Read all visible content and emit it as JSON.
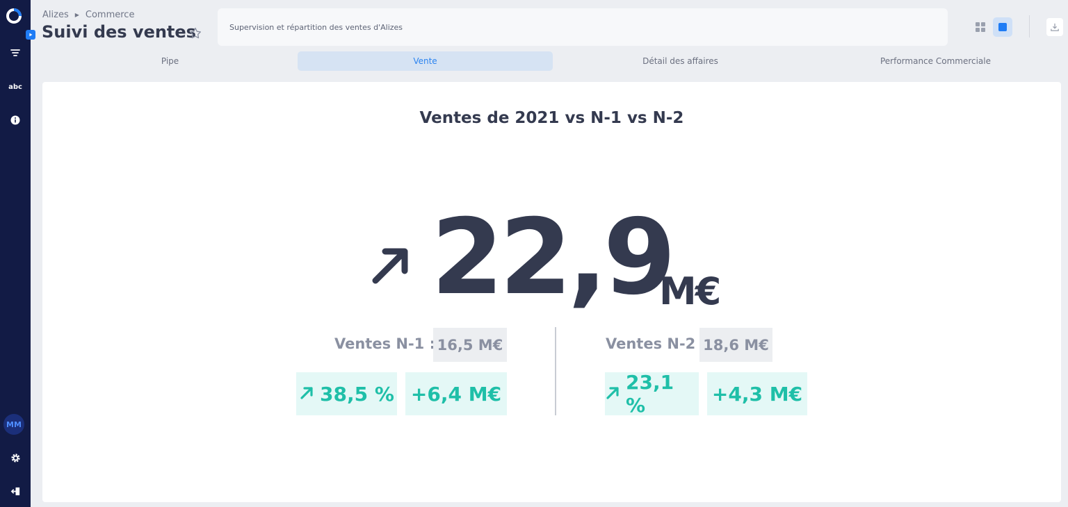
{
  "sidebar": {
    "filter_icon": "filter-icon",
    "abc_label": "abc",
    "info_icon": "info-icon",
    "avatar_initials": "MM",
    "settings_icon": "gear-icon",
    "logout_icon": "logout-icon"
  },
  "header": {
    "breadcrumb": [
      "Alizes",
      "Commerce"
    ],
    "title": "Suivi des ventes",
    "description": "Supervision et répartition des ventes d'Alizes"
  },
  "tabs": [
    {
      "label": "Pipe",
      "active": false
    },
    {
      "label": "Vente",
      "active": true
    },
    {
      "label": "Détail des affaires",
      "active": false
    },
    {
      "label": "Performance Commerciale",
      "active": false
    }
  ],
  "kpi": {
    "title": "Ventes de 2021 vs N-1 vs N-2",
    "value": "22,9",
    "unit": "M€",
    "trend": "up",
    "comparisons": [
      {
        "label": "Ventes N-1 :",
        "value": "16,5 M€",
        "delta_pct": "38,5 %",
        "delta_abs": "+6,4 M€"
      },
      {
        "label": "Ventes N-2",
        "value": "18,6 M€",
        "delta_pct": "23,1 %",
        "delta_abs": "+4,3 M€"
      }
    ]
  },
  "colors": {
    "sidebar": "#121b45",
    "accent": "#1f7cf5",
    "positive": "#1fbfa8",
    "text_dark": "#343a4f"
  }
}
